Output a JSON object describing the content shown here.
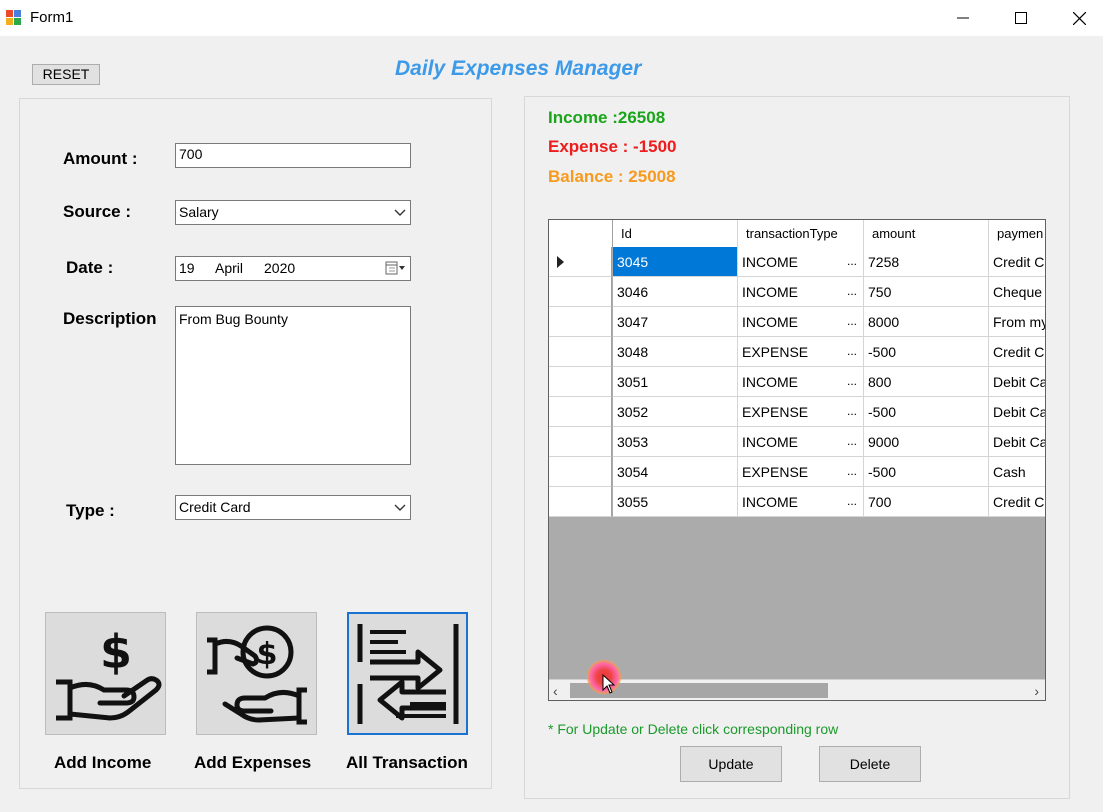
{
  "window": {
    "title": "Form1"
  },
  "toolbar": {
    "reset_label": "RESET"
  },
  "app": {
    "heading": "Daily Expenses Manager"
  },
  "form": {
    "amount_label": "Amount :",
    "amount_value": "700",
    "source_label": "Source :",
    "source_value": "Salary",
    "date_label": "Date :",
    "date_day": "19",
    "date_month": "April",
    "date_year": "2020",
    "description_label": "Description",
    "description_value": "From Bug Bounty",
    "type_label": "Type :",
    "type_value": "Credit Card"
  },
  "actions": {
    "add_income": "Add Income",
    "add_expenses": "Add Expenses",
    "all_transaction": "All Transaction"
  },
  "summary": {
    "income": "Income :26508",
    "expense": "Expense : -1500",
    "balance": "Balance : 25008",
    "income_color": "#1aa51a",
    "expense_color": "#ee1c1c",
    "balance_color": "#f79a1e"
  },
  "grid": {
    "columns": [
      "Id",
      "transactionType",
      "amount",
      "paymen"
    ],
    "rows": [
      {
        "id": "3045",
        "type": "INCOME",
        "amount": "7258",
        "payment": "Credit Ca"
      },
      {
        "id": "3046",
        "type": "INCOME",
        "amount": "750",
        "payment": "Cheque"
      },
      {
        "id": "3047",
        "type": "INCOME",
        "amount": "8000",
        "payment": "From my"
      },
      {
        "id": "3048",
        "type": "EXPENSE",
        "amount": "-500",
        "payment": "Credit Ca"
      },
      {
        "id": "3051",
        "type": "INCOME",
        "amount": "800",
        "payment": "Debit Ca"
      },
      {
        "id": "3052",
        "type": "EXPENSE",
        "amount": "-500",
        "payment": "Debit Ca"
      },
      {
        "id": "3053",
        "type": "INCOME",
        "amount": "9000",
        "payment": "Debit Ca"
      },
      {
        "id": "3054",
        "type": "EXPENSE",
        "amount": "-500",
        "payment": "Cash"
      },
      {
        "id": "3055",
        "type": "INCOME",
        "amount": "700",
        "payment": "Credit Ca"
      }
    ],
    "ellipsis": "...",
    "selected_color": "#0078d7"
  },
  "hint": "* For Update or Delete click corresponding row",
  "buttons": {
    "update": "Update",
    "delete": "Delete"
  }
}
